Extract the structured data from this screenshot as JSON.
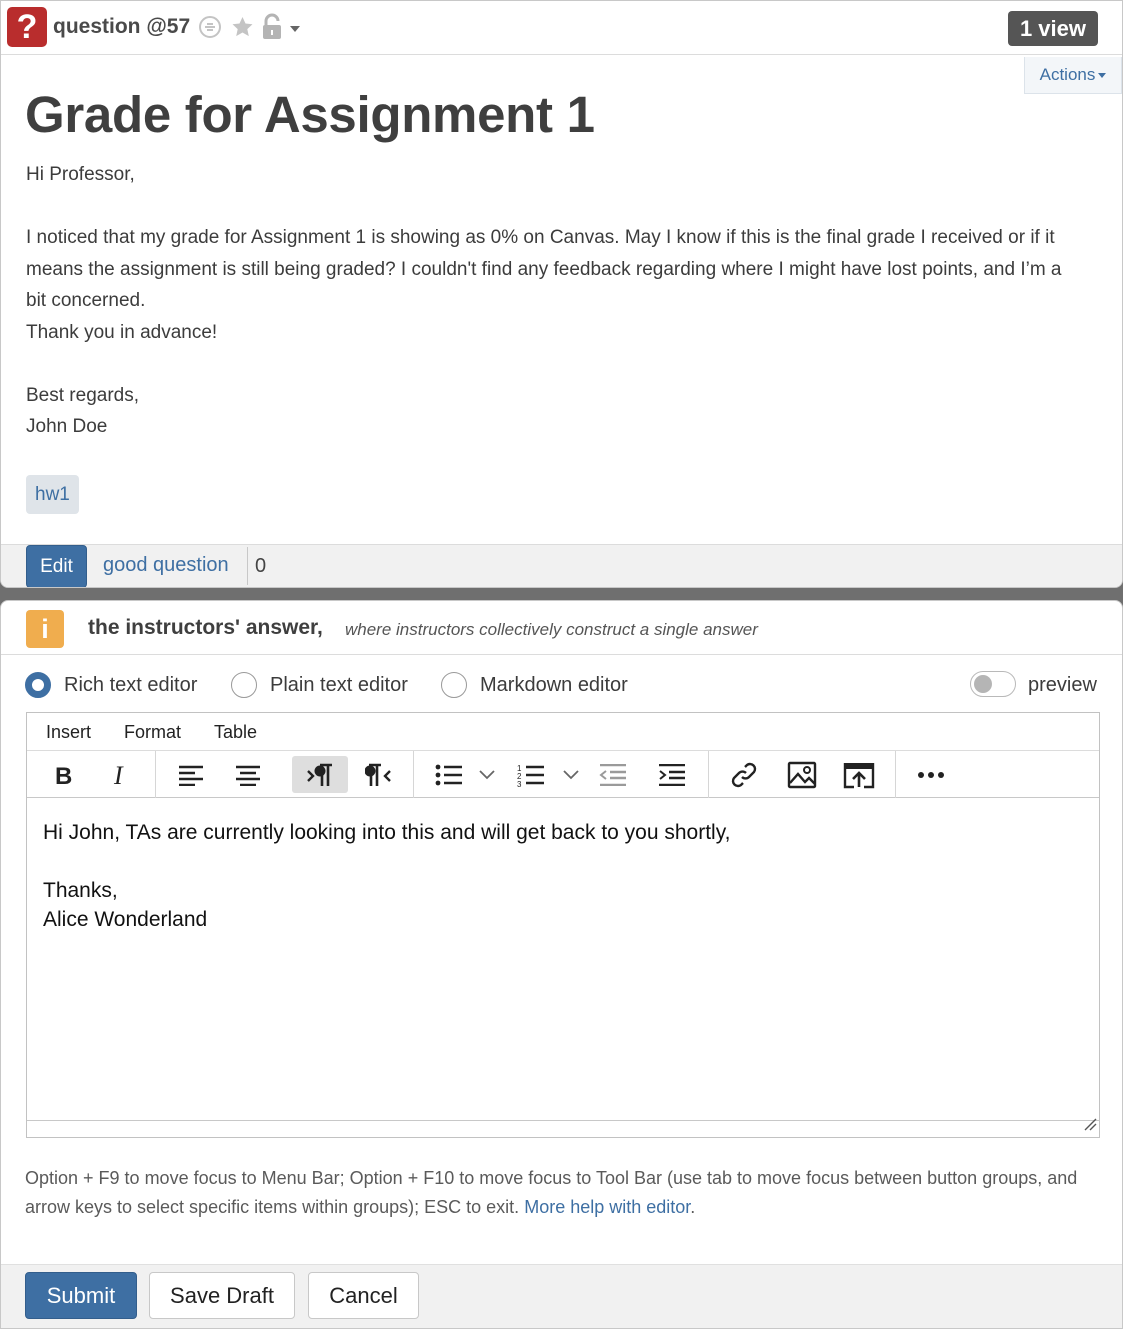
{
  "question": {
    "icon": "?",
    "number": "question @57",
    "views": "1 view",
    "actions_label": "Actions",
    "title": "Grade for Assignment 1",
    "body": [
      "Hi Professor,",
      "",
      "I noticed that my grade for Assignment 1 is showing as 0% on Canvas. May I know if this is the final grade I received or if it means the assignment is still being graded? I couldn't find any feedback regarding where I might have lost points, and I’m a bit concerned.",
      "Thank you in advance!",
      "",
      "Best regards,",
      "John Doe"
    ],
    "tag": "hw1",
    "edit_label": "Edit",
    "good_question_label": "good question",
    "good_question_count": "0"
  },
  "answer": {
    "icon": "i",
    "title": "the instructors' answer,",
    "subtitle": "where instructors collectively construct a single answer",
    "editor_modes": [
      {
        "label": "Rich text editor",
        "selected": true
      },
      {
        "label": "Plain text editor",
        "selected": false
      },
      {
        "label": "Markdown editor",
        "selected": false
      }
    ],
    "preview_label": "preview",
    "preview_on": false,
    "menubar": [
      "Insert",
      "Format",
      "Table"
    ],
    "toolbar_icons": [
      "bold-icon",
      "italic-icon",
      "align-left-icon",
      "align-center-icon",
      "ltr-icon",
      "rtl-icon",
      "bullet-list-icon",
      "numbered-list-icon",
      "outdent-icon",
      "indent-icon",
      "link-icon",
      "image-icon",
      "upload-icon",
      "more-icon"
    ],
    "content": [
      "Hi John, TAs are currently looking into this and will get back to you shortly,",
      "",
      "Thanks,",
      "Alice Wonderland"
    ],
    "help_text": "Option + F9 to move focus to Menu Bar; Option + F10 to move focus to Tool Bar (use tab to move focus between button groups, and arrow keys to select specific items within groups); ESC to exit.",
    "help_link": "More help with editor",
    "submit_label": "Submit",
    "save_draft_label": "Save Draft",
    "cancel_label": "Cancel"
  },
  "colors": {
    "accent": "#3e6fa3",
    "question_icon": "#b92d2d",
    "answer_icon": "#f0ad4e"
  }
}
